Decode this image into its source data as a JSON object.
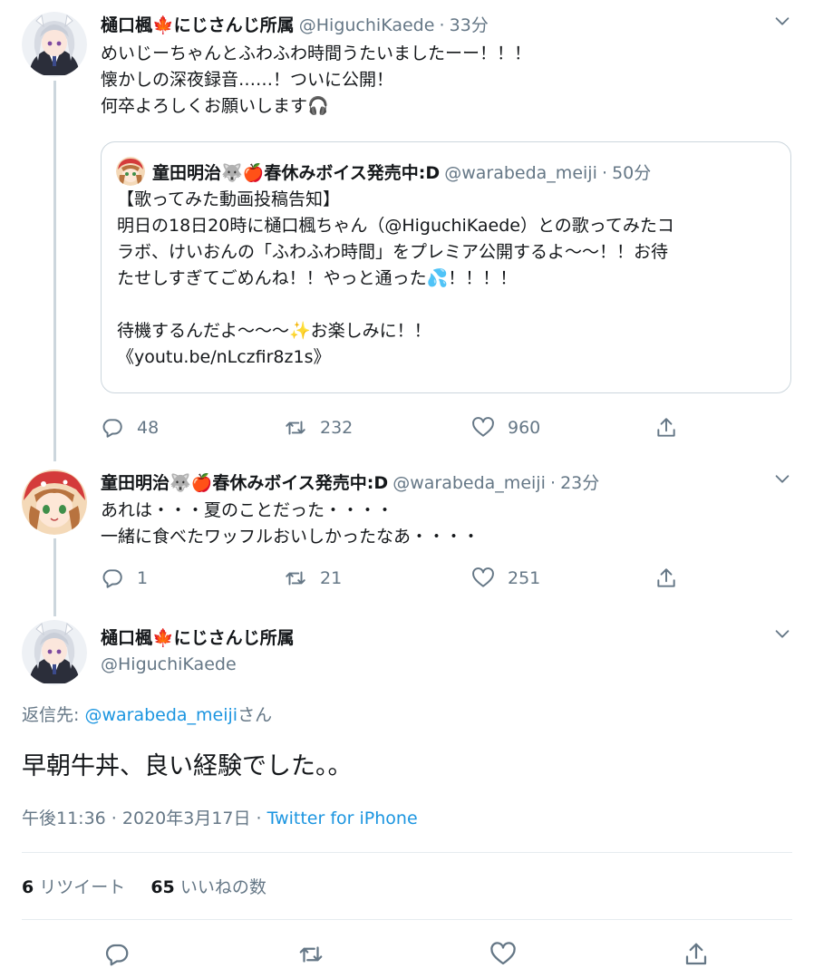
{
  "tweet1": {
    "name": "樋口楓🍁にじさんじ所属",
    "handle": "@HiguchiKaede",
    "time": "33分",
    "lines": [
      "めいじーちゃんとふわふわ時間うたいましたーー！！！",
      "懐かしの深夜録音……！ついに公開！",
      "何卒よろしくお願いします🎧"
    ],
    "quote": {
      "name": "童田明治🐺🍎春休みボイス発売中:D",
      "handle": "@warabeda_meiji",
      "time": "50分",
      "lines": [
        "【歌ってみた動画投稿告知】",
        "明日の18日20時に樋口楓ちゃん（@HiguchiKaede）との歌ってみたコ",
        "ラボ、けいおんの「ふわふわ時間」をプレミア公開するよ～～！！お待",
        "たせしすぎてごめんね！！やっと通った💦！！！！",
        "",
        "待機するんだよ～～～✨お楽しみに！！",
        "《youtu.be/nLczfir8z1s》"
      ]
    },
    "replies": "48",
    "retweets": "232",
    "likes": "960"
  },
  "tweet2": {
    "name": "童田明治🐺🍎春休みボイス発売中:D",
    "handle": "@warabeda_meiji",
    "time": "23分",
    "lines": [
      "あれは・・・夏のことだった・・・・",
      "一緒に食べたワッフルおいしかったなあ・・・・"
    ],
    "replies": "1",
    "retweets": "21",
    "likes": "251"
  },
  "main": {
    "name": "樋口楓🍁にじさんじ所属",
    "handle": "@HiguchiKaede",
    "reply_prefix": "返信先: ",
    "reply_to": "@warabeda_meiji",
    "reply_suffix": "さん",
    "text": "早朝牛丼、良い経験でした。。",
    "timestamp": "午後11:36 · 2020年3月17日 · ",
    "client": "Twitter for iPhone",
    "retweet_count": "6",
    "retweet_label": " リツイート",
    "like_count": "65",
    "like_label": " いいねの数"
  },
  "separator": "·",
  "colors": {
    "text": "#14171a",
    "secondary": "#657786",
    "link": "#1b95e0",
    "border": "#ccd6dd",
    "divider": "#e6ecf0"
  }
}
